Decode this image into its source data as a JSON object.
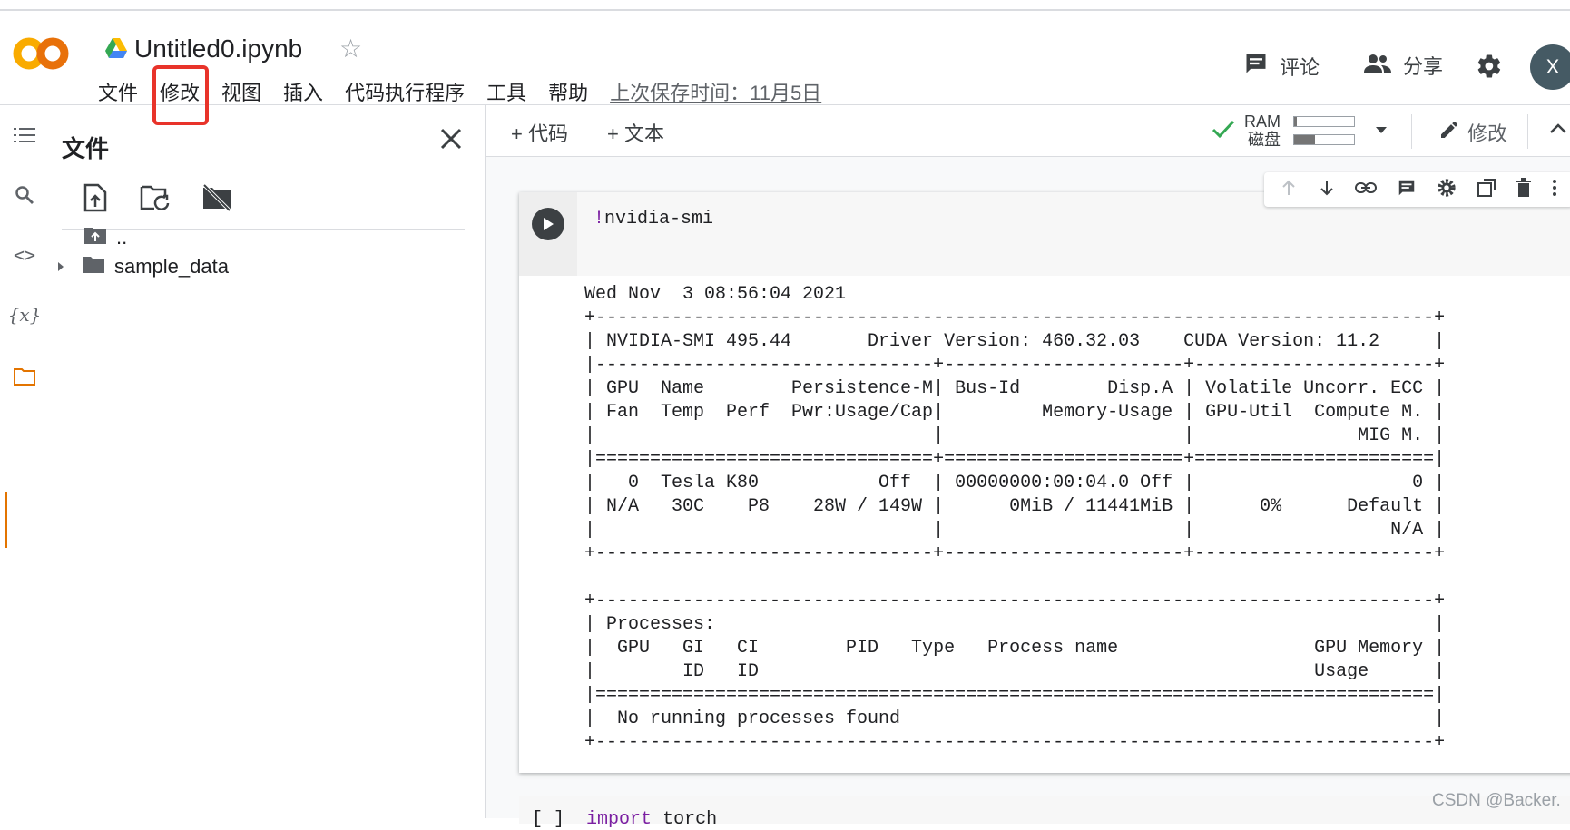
{
  "header": {
    "notebook_title": "Untitled0.ipynb",
    "menu": [
      "文件",
      "修改",
      "视图",
      "插入",
      "代码执行程序",
      "工具",
      "帮助"
    ],
    "highlighted_menu_index": 1,
    "last_saved": "上次保存时间：11月5日",
    "comment_label": "评论",
    "share_label": "分享",
    "avatar_letter": "X"
  },
  "sidebar": {
    "icons": [
      "table-of-contents-icon",
      "search-icon",
      "code-snippets-icon",
      "variables-icon",
      "files-icon"
    ],
    "variables_glyph": "{x}",
    "active": "files-icon"
  },
  "files_panel": {
    "title": "文件",
    "tools": [
      "upload-icon",
      "refresh-icon",
      "unmount-drive-icon"
    ],
    "tree": [
      {
        "name": "..",
        "icon": "folder-up-icon"
      },
      {
        "name": "sample_data",
        "icon": "folder-icon",
        "expandable": true
      }
    ]
  },
  "toolbar": {
    "add_code": "+ 代码",
    "add_text": "+ 文本",
    "ram_label": "RAM",
    "disk_label": "磁盘",
    "ram_usage": 0.05,
    "disk_usage": 0.35,
    "edit_label": "修改"
  },
  "cell": {
    "bang": "!",
    "command": "nvidia-smi",
    "output": [
      "Wed Nov  3 08:56:04 2021",
      "+-----------------------------------------------------------------------------+",
      "| NVIDIA-SMI 495.44       Driver Version: 460.32.03    CUDA Version: 11.2     |",
      "|-------------------------------+----------------------+----------------------+",
      "| GPU  Name        Persistence-M| Bus-Id        Disp.A | Volatile Uncorr. ECC |",
      "| Fan  Temp  Perf  Pwr:Usage/Cap|         Memory-Usage | GPU-Util  Compute M. |",
      "|                               |                      |               MIG M. |",
      "|===============================+======================+======================|",
      "|   0  Tesla K80           Off  | 00000000:00:04.0 Off |                    0 |",
      "| N/A   30C    P8    28W / 149W |      0MiB / 11441MiB |      0%      Default |",
      "|                               |                      |                  N/A |",
      "+-------------------------------+----------------------+----------------------+",
      "",
      "+-----------------------------------------------------------------------------+",
      "| Processes:                                                                  |",
      "|  GPU   GI   CI        PID   Type   Process name                  GPU Memory |",
      "|        ID   ID                                                   Usage      |",
      "|=============================================================================|",
      "|  No running processes found                                                 |",
      "+-----------------------------------------------------------------------------+"
    ]
  },
  "next_cell": {
    "prompt": "[ ]",
    "keyword": "import",
    "rest": "torch"
  },
  "watermark": "CSDN @Backer."
}
